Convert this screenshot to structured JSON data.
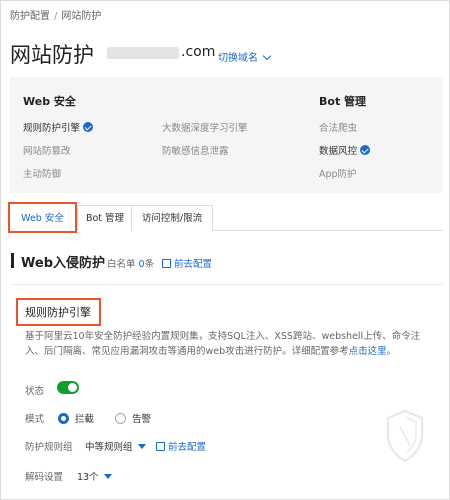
{
  "breadcrumb": {
    "parent": "防护配置",
    "separator": "/",
    "current": "网站防护"
  },
  "header": {
    "title": "网站防护",
    "domain_suffix": ".com",
    "switch_domain": "切换域名"
  },
  "overview": {
    "web_security": {
      "heading": "Web 安全",
      "items": [
        "规则防护引擎",
        "大数据深度学习引擎",
        "网站防篡改",
        "防敏感信息泄露",
        "主动防御"
      ]
    },
    "bot_management": {
      "heading": "Bot 管理",
      "items": [
        "合法爬虫",
        "数据风控",
        "App防护"
      ]
    }
  },
  "tabs": [
    "Web 安全",
    "Bot 管理",
    "访问控制/限流"
  ],
  "section": {
    "title": "Web入侵防护",
    "whitelist_label": "白名单",
    "whitelist_count": "0",
    "whitelist_unit": "条",
    "configure_link": "前去配置"
  },
  "engine": {
    "title": "规则防护引擎",
    "description": "基于阿里云10年安全防护经验内置规则集，支持SQL注入、XSS跨站、webshell上传、命令注入、后门隔离、常见应用漏洞攻击等通用的web攻击进行防护。详细配置参考",
    "description_link": "点击这里",
    "description_end": "。",
    "status_label": "状态",
    "mode_label": "模式",
    "mode_options": [
      "拦截",
      "告警"
    ],
    "ruleset_label": "防护规则组",
    "ruleset_value": "中等规则组",
    "ruleset_link": "前去配置",
    "decode_label": "解码设置",
    "decode_value": "13个"
  },
  "colors": {
    "accent": "#1a6ac9",
    "highlight": "#e8542e",
    "toggle_on": "#0f9f2c"
  }
}
